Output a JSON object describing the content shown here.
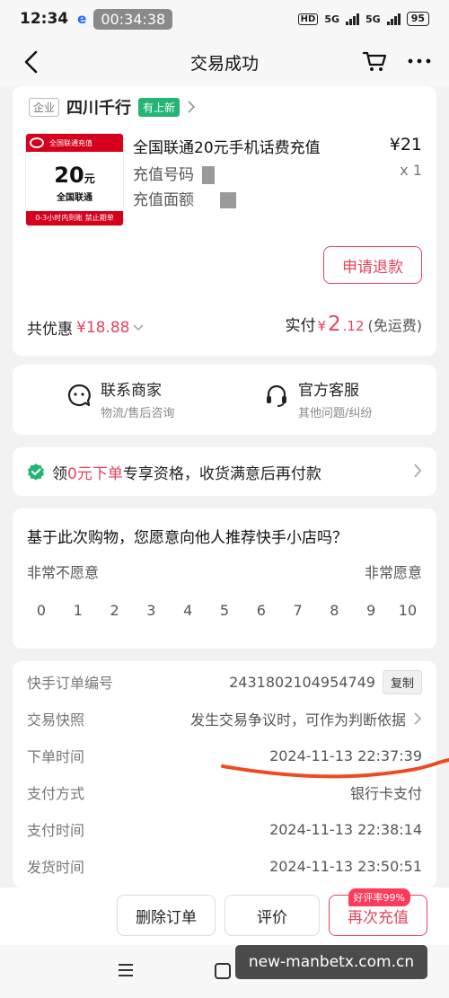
{
  "status_bar": {
    "time": "12:34",
    "carrier": "e",
    "recording": "00:34:38",
    "hd": "HD",
    "net1": "5G",
    "net2": "5G",
    "battery": "95"
  },
  "header": {
    "title": "交易成功"
  },
  "shop": {
    "tag": "企业",
    "name": "四川千行",
    "new_tag": "有上新"
  },
  "product": {
    "image": {
      "brand_small": "China unicom中国联通",
      "banner": "全国联通充值",
      "amount": "20",
      "amount_unit": "元",
      "sub": "全国联通",
      "footer": "0-3小时内到账 禁止期单"
    },
    "name": "全国联通20元手机话费充值",
    "phone_label": "充值号码",
    "amount_label": "充值面额",
    "price": "¥21",
    "qty": "x 1"
  },
  "refund_button": "申请退款",
  "discount": {
    "label": "共优惠",
    "value": "¥18.88"
  },
  "paid": {
    "label": "实付",
    "currency": "¥",
    "integer": "2",
    "decimal": ".12",
    "shipping": "(免运费)"
  },
  "contact": {
    "merchant_title": "联系商家",
    "merchant_sub": "物流/售后咨询",
    "service_title": "官方客服",
    "service_sub": "其他问题/纠纷"
  },
  "promo": {
    "pre": "领",
    "highlight": "0元下单",
    "post": "专享资格，收货满意后再付款"
  },
  "survey": {
    "question": "基于此次购物，您愿意向他人推荐快手小店吗？",
    "low_label": "非常不愿意",
    "high_label": "非常愿意",
    "scale": [
      "0",
      "1",
      "2",
      "3",
      "4",
      "5",
      "6",
      "7",
      "8",
      "9",
      "10"
    ]
  },
  "order_info": {
    "order_no_label": "快手订单编号",
    "order_no": "2431802104954749",
    "copy_label": "复制",
    "snapshot_label": "交易快照",
    "snapshot_value": "发生交易争议时，可作为判断依据",
    "order_time_label": "下单时间",
    "order_time": "2024-11-13 22:37:39",
    "pay_method_label": "支付方式",
    "pay_method": "银行卡支付",
    "pay_time_label": "支付时间",
    "pay_time": "2024-11-13 22:38:14",
    "ship_time_label": "发货时间",
    "ship_time": "2024-11-13 23:50:51"
  },
  "bottom_bar": {
    "delete": "删除订单",
    "review": "评价",
    "recharge_again": "再次充值",
    "rating_badge": "好评率99%"
  },
  "watermark": "new-manbetx.com.cn",
  "colors": {
    "accent": "#e3455a",
    "green": "#22b573",
    "carrier_blue": "#1769ff",
    "unicom_red": "#d6001c"
  }
}
